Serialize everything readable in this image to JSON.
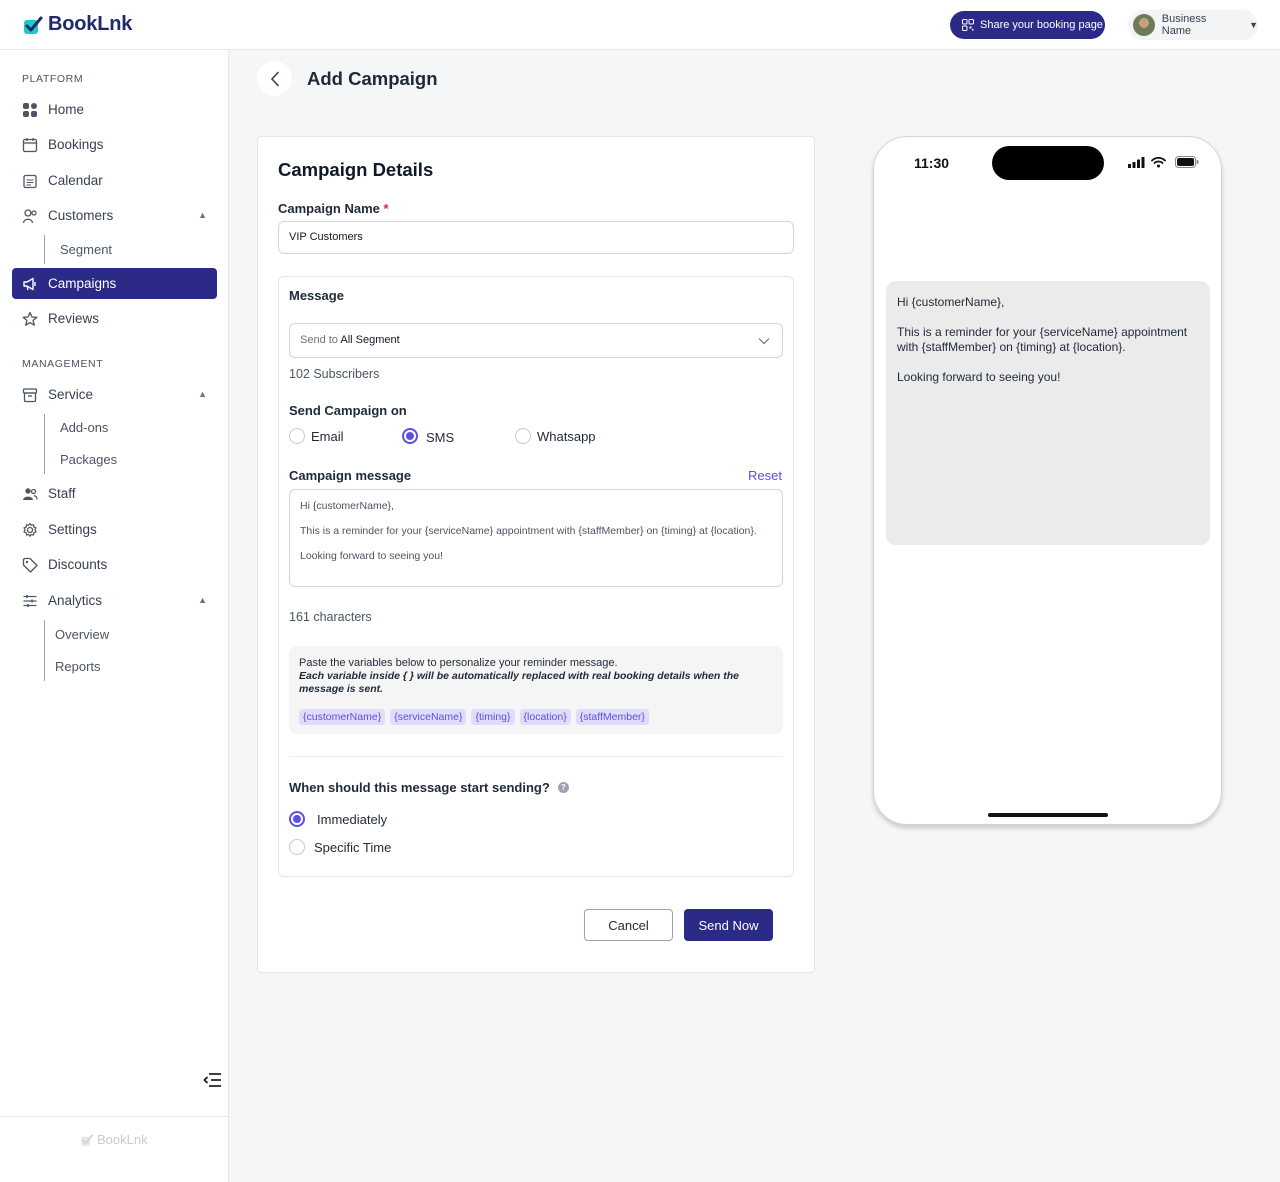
{
  "app": {
    "name": "BookLnk"
  },
  "header": {
    "share_label": "Share your booking page",
    "business_name": "Business Name"
  },
  "sidebar": {
    "platform_title": "PLATFORM",
    "management_title": "MANAGEMENT",
    "items": {
      "home": "Home",
      "bookings": "Bookings",
      "calendar": "Calendar",
      "customers": "Customers",
      "segment": "Segment",
      "campaigns": "Campaigns",
      "reviews": "Reviews",
      "service": "Service",
      "addons": "Add-ons",
      "packages": "Packages",
      "staff": "Staff",
      "settings": "Settings",
      "discounts": "Discounts",
      "analytics": "Analytics",
      "overview": "Overview",
      "reports": "Reports"
    },
    "footer_logo": "BookLnk"
  },
  "page": {
    "title": "Add Campaign"
  },
  "form": {
    "section_title": "Campaign Details",
    "name_label": "Campaign Name",
    "required_mark": "*",
    "name_value": "VIP Customers",
    "message_title": "Message",
    "send_to_prefix": "Send to",
    "send_to_value": "All Segment",
    "subscribers": "102 Subscribers",
    "channel_label": "Send Campaign on",
    "channels": [
      "Email",
      "SMS",
      "Whatsapp"
    ],
    "selected_channel": "SMS",
    "message_label": "Campaign message",
    "reset_label": "Reset",
    "message_text": "Hi {customerName},\n\nThis is a reminder for your {serviceName} appointment with {staffMember} on {timing} at {location}.\n\nLooking forward to seeing you!",
    "char_count": "161 characters",
    "hint_line1": "Paste the variables below to personalize your reminder message.",
    "hint_line2": "Each variable inside { } will be automatically replaced with real booking details when the message is sent.",
    "variables": [
      "{customerName}",
      "{serviceName}",
      "{timing}",
      "{location}",
      "{staffMember}"
    ],
    "timing_question": "When should this message start sending?",
    "timing_options": [
      "Immediately",
      "Specific Time"
    ],
    "timing_selected": "Immediately",
    "cancel_label": "Cancel",
    "send_label": "Send Now"
  },
  "preview": {
    "time": "11:30",
    "message": "Hi {customerName},\n\nThis is a reminder for your {serviceName} appointment with {staffMember} on {timing} at {location}.\n\nLooking forward to seeing you!"
  },
  "colors": {
    "primary": "#2b2a86",
    "accent": "#5b50e6",
    "logo_teal": "#1fc7c7"
  }
}
